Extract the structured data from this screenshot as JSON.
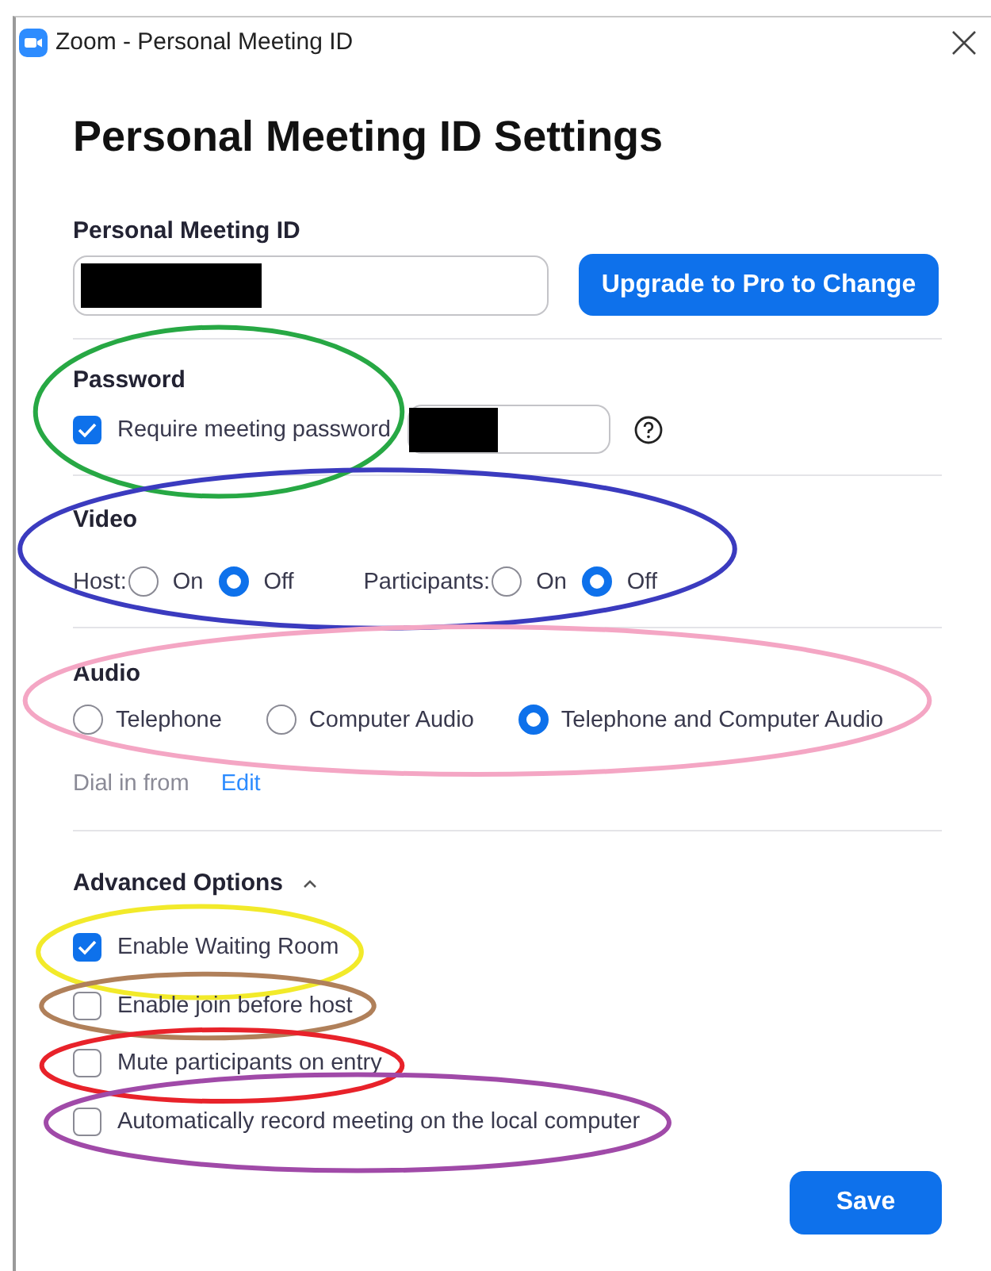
{
  "window": {
    "title": "Zoom - Personal Meeting ID"
  },
  "heading": "Personal Meeting ID Settings",
  "meeting_id": {
    "label": "Personal Meeting ID",
    "button": "Upgrade to Pro to Change"
  },
  "password": {
    "label": "Password",
    "color": "#27a844",
    "checkbox": {
      "label": "Require meeting password",
      "checked": true
    }
  },
  "video": {
    "label": "Video",
    "color": "#3b3bbf",
    "groups": [
      {
        "label": "Host:",
        "options": [
          {
            "label": "On",
            "selected": false
          },
          {
            "label": "Off",
            "selected": true
          }
        ]
      },
      {
        "label": "Participants:",
        "options": [
          {
            "label": "On",
            "selected": false
          },
          {
            "label": "Off",
            "selected": true
          }
        ]
      }
    ]
  },
  "audio": {
    "label": "Audio",
    "color": "#f4a6c4",
    "options": [
      {
        "label": "Telephone",
        "selected": false
      },
      {
        "label": "Computer Audio",
        "selected": false
      },
      {
        "label": "Telephone and Computer Audio",
        "selected": true
      }
    ],
    "dial_in": {
      "label": "Dial in from",
      "link": "Edit"
    }
  },
  "advanced": {
    "label": "Advanced Options",
    "expanded": true,
    "options": [
      {
        "label": "Enable Waiting Room",
        "checked": true,
        "color": "#f2ea2a"
      },
      {
        "label": "Enable join before host",
        "checked": false,
        "color": "#b0805a"
      },
      {
        "label": "Mute participants on entry",
        "checked": false,
        "color": "#e8222a"
      },
      {
        "label": "Automatically record meeting on the local computer",
        "checked": false,
        "color": "#a04aa8"
      }
    ]
  },
  "save": "Save"
}
